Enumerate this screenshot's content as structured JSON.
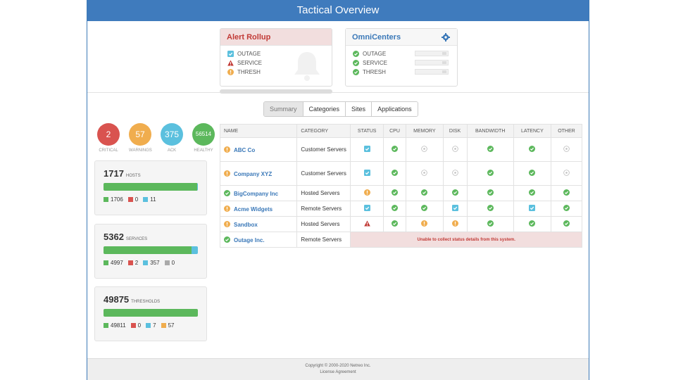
{
  "header": {
    "title": "Tactical Overview"
  },
  "alert_rollup": {
    "title": "Alert Rollup",
    "rows": [
      {
        "label": "OUTAGE",
        "icon": "check-box-icon"
      },
      {
        "label": "SERVICE",
        "icon": "warning-triangle-icon"
      },
      {
        "label": "THRESH",
        "icon": "exclamation-circle-icon"
      }
    ]
  },
  "omnicenters": {
    "title": "OmniCenters",
    "rows": [
      {
        "label": "OUTAGE",
        "icon": "check-circle-icon"
      },
      {
        "label": "SERVICE",
        "icon": "check-circle-icon"
      },
      {
        "label": "THRESH",
        "icon": "check-circle-icon"
      }
    ]
  },
  "tabs": [
    "Summary",
    "Categories",
    "Sites",
    "Applications"
  ],
  "summary_circles": [
    {
      "value": "2",
      "label": "CRITICAL",
      "color": "#d9534f"
    },
    {
      "value": "57",
      "label": "WARNINGS",
      "color": "#f0ad4e"
    },
    {
      "value": "375",
      "label": "ACK",
      "color": "#5bc0de"
    },
    {
      "value": "56514",
      "label": "HEALTHY",
      "color": "#5cb85c"
    }
  ],
  "stats": [
    {
      "total": "1717",
      "unit": "HOSTS",
      "bar": [
        {
          "fraction": 0.994,
          "color": "#5cb85c"
        },
        {
          "fraction": 0.006,
          "color": "#5bc0de"
        }
      ],
      "legend": [
        {
          "value": "1706",
          "color": "#5cb85c"
        },
        {
          "value": "0",
          "color": "#d9534f"
        },
        {
          "value": "11",
          "color": "#5bc0de"
        }
      ]
    },
    {
      "total": "5362",
      "unit": "SERVICES",
      "bar": [
        {
          "fraction": 0.93,
          "color": "#5cb85c"
        },
        {
          "fraction": 0.07,
          "color": "#5bc0de"
        }
      ],
      "legend": [
        {
          "value": "4997",
          "color": "#5cb85c"
        },
        {
          "value": "2",
          "color": "#d9534f"
        },
        {
          "value": "357",
          "color": "#5bc0de"
        },
        {
          "value": "0",
          "color": "#aaaaaa"
        }
      ]
    },
    {
      "total": "49875",
      "unit": "THRESHOLDS",
      "bar": [
        {
          "fraction": 0.999,
          "color": "#5cb85c"
        },
        {
          "fraction": 0.001,
          "color": "#5bc0de"
        }
      ],
      "legend": [
        {
          "value": "49811",
          "color": "#5cb85c"
        },
        {
          "value": "0",
          "color": "#d9534f"
        },
        {
          "value": "7",
          "color": "#5bc0de"
        },
        {
          "value": "57",
          "color": "#f0ad4e"
        }
      ]
    }
  ],
  "table": {
    "columns": [
      "NAME",
      "CATEGORY",
      "STATUS",
      "CPU",
      "MEMORY",
      "DISK",
      "BANDWIDTH",
      "LATENCY",
      "OTHER"
    ],
    "rows": [
      {
        "name": "ABC Co",
        "name_icon": "exclamation-circle-icon",
        "category": "Customer Servers",
        "cells": [
          "check-box-icon",
          "check-circle-icon",
          "na-circle-icon",
          "na-circle-icon",
          "check-circle-icon",
          "check-circle-icon",
          "na-circle-icon"
        ]
      },
      {
        "name": "Company XYZ",
        "name_icon": "exclamation-circle-icon",
        "category": "Customer Servers",
        "cells": [
          "check-box-icon",
          "check-circle-icon",
          "na-circle-icon",
          "na-circle-icon",
          "check-circle-icon",
          "check-circle-icon",
          "na-circle-icon"
        ]
      },
      {
        "name": "BigCompany Inc",
        "name_icon": "check-circle-icon",
        "category": "Hosted Servers",
        "cells": [
          "exclamation-circle-icon",
          "check-circle-icon",
          "check-circle-icon",
          "check-circle-icon",
          "check-circle-icon",
          "check-circle-icon",
          "check-circle-icon"
        ]
      },
      {
        "name": "Acme Widgets",
        "name_icon": "exclamation-circle-icon",
        "category": "Remote Servers",
        "cells": [
          "check-box-icon",
          "check-circle-icon",
          "check-circle-icon",
          "check-box-icon",
          "check-circle-icon",
          "check-box-icon",
          "check-circle-icon"
        ]
      },
      {
        "name": "Sandbox",
        "name_icon": "exclamation-circle-icon",
        "category": "Hosted Servers",
        "cells": [
          "warning-triangle-icon",
          "check-circle-icon",
          "exclamation-circle-icon",
          "exclamation-circle-icon",
          "check-circle-icon",
          "check-circle-icon",
          "check-circle-icon"
        ]
      },
      {
        "name": "Outage Inc.",
        "name_icon": "check-circle-icon",
        "category": "Remote Servers",
        "error": "Unable to collect status details from this system."
      }
    ]
  },
  "footer": {
    "copyright": "Copyright © 2000-2020 Netreo Inc.",
    "license": "License Agreement"
  }
}
